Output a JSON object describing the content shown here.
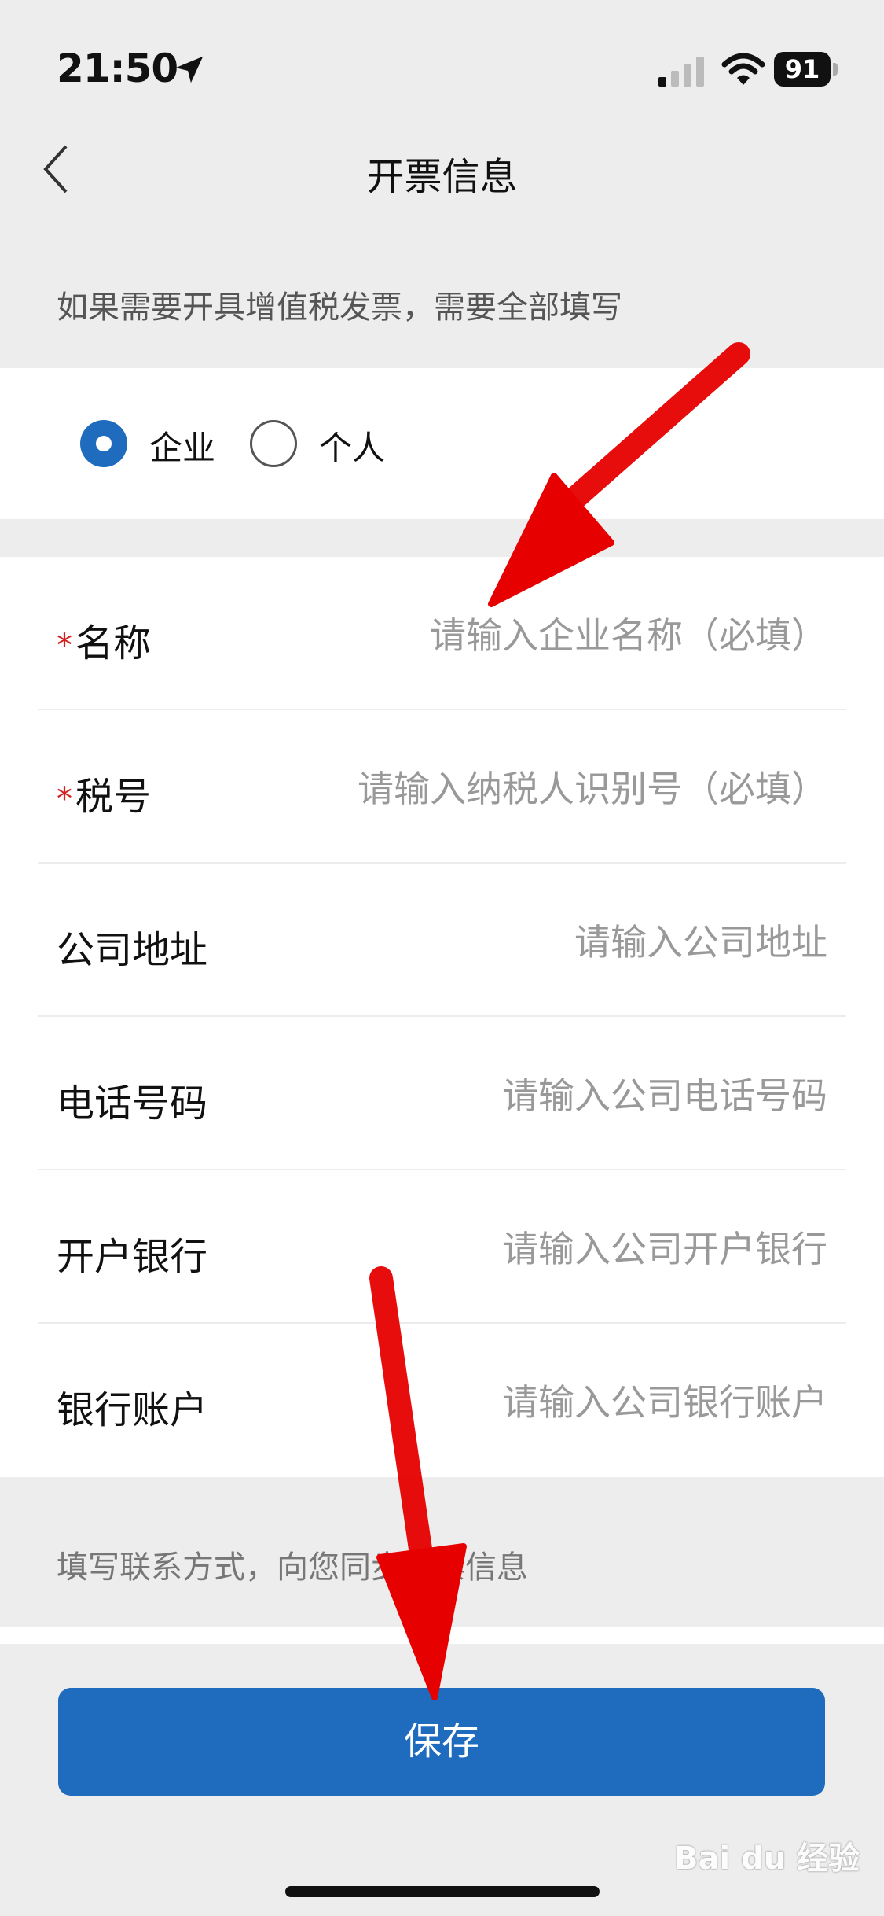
{
  "status_bar": {
    "time": "21:50",
    "battery": "91"
  },
  "nav": {
    "title": "开票信息"
  },
  "hint": "如果需要开具增值税发票，需要全部填写",
  "invoice_type": {
    "options": [
      {
        "label": "企业",
        "selected": true
      },
      {
        "label": "个人",
        "selected": false
      }
    ]
  },
  "form": {
    "rows": [
      {
        "label": "名称",
        "required": true,
        "required_mark": "*",
        "placeholder": "请输入企业名称（必填）"
      },
      {
        "label": "税号",
        "required": true,
        "required_mark": "*",
        "placeholder": "请输入纳税人识别号（必填）"
      },
      {
        "label": "公司地址",
        "required": false,
        "placeholder": "请输入公司地址"
      },
      {
        "label": "电话号码",
        "required": false,
        "placeholder": "请输入公司电话号码"
      },
      {
        "label": "开户银行",
        "required": false,
        "placeholder": "请输入公司开户银行"
      },
      {
        "label": "银行账户",
        "required": false,
        "placeholder": "请输入公司银行账户"
      }
    ]
  },
  "contact_hint": "填写联系方式，向您同步发票信息",
  "save_label": "保存",
  "watermark": "Bai du 经验",
  "colors": {
    "accent": "#1f6bbd",
    "required": "#d41f1f",
    "annotation_arrow": "#e60000"
  }
}
